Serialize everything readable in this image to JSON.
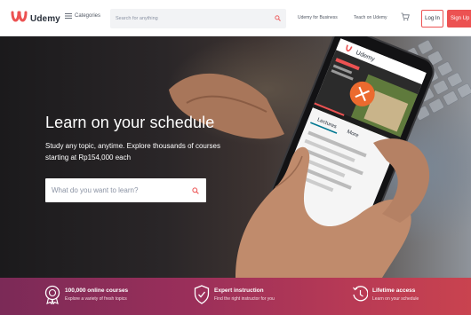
{
  "header": {
    "brand": "Udemy",
    "categories_label": "Categories",
    "search_placeholder": "Search for anything",
    "links": [
      "Udemy for Business",
      "Teach on Udemy"
    ],
    "login_label": "Log In",
    "signup_label": "Sign Up",
    "brand_color": "#ec5252"
  },
  "hero": {
    "title": "Learn on your schedule",
    "subtitle": "Study any topic, anytime. Explore thousands of courses starting at Rp154,000 each",
    "search_placeholder": "What do you want to learn?"
  },
  "features": [
    {
      "icon": "badge-icon",
      "title": "100,000 online courses",
      "desc": "Explore a variety of fresh topics"
    },
    {
      "icon": "check-shield-icon",
      "title": "Expert instruction",
      "desc": "Find the right instructor for you"
    },
    {
      "icon": "clock-icon",
      "title": "Lifetime access",
      "desc": "Learn on your schedule"
    }
  ],
  "phone_screen": {
    "brand": "Udemy",
    "labels": [
      "Lectures",
      "More"
    ]
  }
}
